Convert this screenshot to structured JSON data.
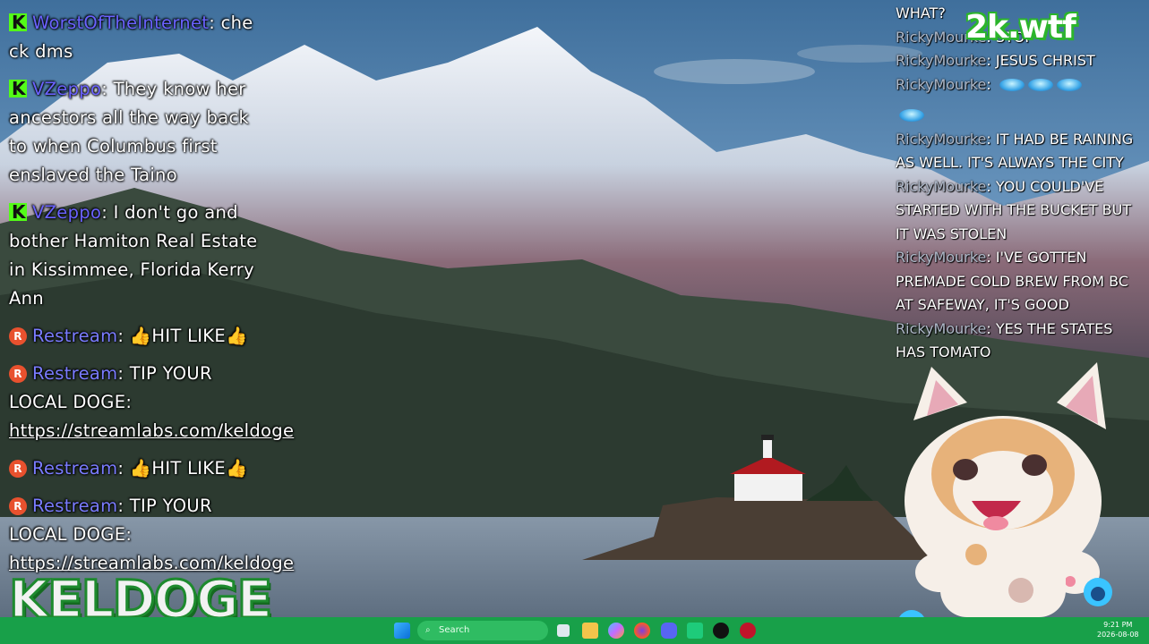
{
  "left_chat": [
    {
      "icon": "kick",
      "user": "WorstOfTheInternet",
      "text": "che ck dms"
    },
    {
      "icon": "kick",
      "user": "VZeppo",
      "text": "They know her ancestors all the way back to when Columbus first enslaved the Taino"
    },
    {
      "icon": "kick",
      "user": "VZeppo",
      "text": "I don't go and bother Hamiton Real Estate in Kissimmee, Florida Kerry Ann"
    },
    {
      "icon": "restream",
      "user": "Restream",
      "text": "👍HIT LIKE👍"
    },
    {
      "icon": "restream",
      "user": "Restream",
      "text": "TIP YOUR LOCAL DOGE: ",
      "link": "https://streamlabs.com/keldoge"
    },
    {
      "icon": "restream",
      "user": "Restream",
      "text": "👍HIT LIKE👍"
    },
    {
      "icon": "restream",
      "user": "Restream",
      "text": "TIP YOUR LOCAL DOGE: ",
      "link": "https://streamlabs.com/keldoge"
    }
  ],
  "right_chat": [
    {
      "user": "",
      "text": "WHAT?"
    },
    {
      "user": "RickyMourke",
      "text": "STOP"
    },
    {
      "user": "RickyMourke",
      "text": "JESUS CHRIST"
    },
    {
      "user": "RickyMourke",
      "text": "",
      "emotes": 3
    },
    {
      "user": "",
      "text": "",
      "emotes": 1
    },
    {
      "user": "RickyMourke",
      "text": "IT HAD BE RAINING AS WELL. IT'S ALWAYS THE CITY"
    },
    {
      "user": "RickyMourke",
      "text": "YOU COULD'VE STARTED WITH THE BUCKET BUT IT WAS STOLEN"
    },
    {
      "user": "RickyMourke",
      "text": "I'VE GOTTEN PREMADE COLD BREW FROM BC AT SAFEWAY, IT'S GOOD"
    },
    {
      "user": "RickyMourke",
      "text": "YES THE STATES HAS TOMATO"
    }
  ],
  "logos": {
    "top_right": "2k.wtf",
    "bottom_left": "KELDOGE"
  },
  "taskbar": {
    "search_label": "Search",
    "time": "9:21 PM",
    "date": "2026-08-08"
  },
  "colors": {
    "taskbar": "#18a049",
    "kick": "#53fc18",
    "restream": "#e8512e"
  }
}
